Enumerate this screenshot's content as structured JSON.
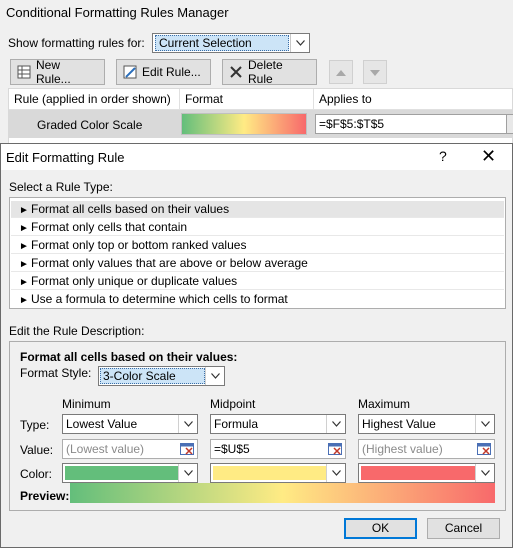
{
  "manager": {
    "title": "Conditional Formatting Rules Manager",
    "show_rules_label": "Show formatting rules for:",
    "show_rules_value": "Current Selection",
    "buttons": {
      "new_rule": "New Rule...",
      "edit_rule": "Edit Rule...",
      "delete_rule": "Delete Rule"
    },
    "columns": {
      "rule": "Rule (applied in order shown)",
      "format": "Format",
      "applies_to": "Applies to"
    },
    "rule_row": {
      "name": "Graded Color Scale",
      "applies_to": "=$F$5:$T$5"
    }
  },
  "edit_dialog": {
    "title": "Edit Formatting Rule",
    "help": "?",
    "close": "✕",
    "select_rule_type_label": "Select a Rule Type:",
    "rule_types": [
      "Format all cells based on their values",
      "Format only cells that contain",
      "Format only top or bottom ranked values",
      "Format only values that are above or below average",
      "Format only unique or duplicate values",
      "Use a formula to determine which cells to format"
    ],
    "selected_rule_type_index": 0,
    "edit_description_label": "Edit the Rule Description:",
    "format_all_heading": "Format all cells based on their values:",
    "format_style_label": "Format Style:",
    "format_style_value": "3-Color Scale",
    "columns": {
      "minimum": "Minimum",
      "midpoint": "Midpoint",
      "maximum": "Maximum"
    },
    "row_labels": {
      "type": "Type:",
      "value": "Value:",
      "color": "Color:"
    },
    "minimum": {
      "type": "Lowest Value",
      "value": "(Lowest value)",
      "color": "#63be7b"
    },
    "midpoint": {
      "type": "Formula",
      "value": "=$U$5",
      "color": "#ffeb84"
    },
    "maximum": {
      "type": "Highest Value",
      "value": "(Highest value)",
      "color": "#f8696b"
    },
    "preview_label": "Preview:",
    "ok": "OK",
    "cancel": "Cancel"
  },
  "icons": [
    "new-rule-icon",
    "edit-rule-icon",
    "delete-rule-icon",
    "move-up-icon",
    "move-down-icon",
    "chevron-down-icon",
    "range-picker-icon",
    "close-icon"
  ]
}
